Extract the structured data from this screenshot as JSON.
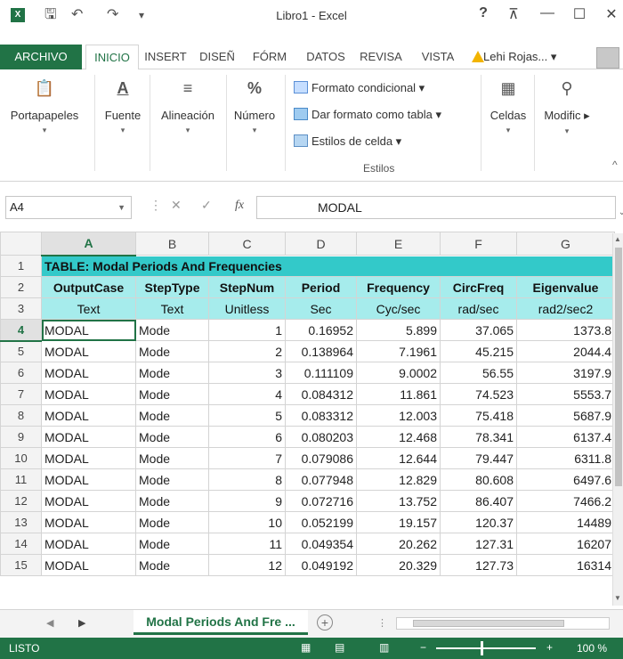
{
  "window": {
    "title": "Libro1 - Excel",
    "help": "?",
    "restore_ribbon": "⊼",
    "minimize": "—",
    "maximize": "☐",
    "close": "✕"
  },
  "ribbon_tabs": [
    "ARCHIVO",
    "INICIO",
    "INSERT",
    "DISEÑ",
    "FÓRM",
    "DATOS",
    "REVISA",
    "VISTA"
  ],
  "user_name": "Lehi Rojas... ▾",
  "ribbon": {
    "clipboard": "Portapapeles",
    "font": "Fuente",
    "alignment": "Alineación",
    "number": "Número",
    "conditional_format": "Formato condicional ▾",
    "format_as_table": "Dar formato como tabla ▾",
    "cell_styles": "Estilos de celda ▾",
    "styles_group": "Estilos",
    "cells": "Celdas",
    "modify": "Modific ▸"
  },
  "formula_bar": {
    "name_box": "A4",
    "fx": "fx",
    "value": "MODAL"
  },
  "columns": [
    "A",
    "B",
    "C",
    "D",
    "E",
    "F",
    "G"
  ],
  "rows": [
    {
      "n": "1",
      "cells": [
        "TABLE:  Modal Periods And Frequencies",
        "",
        "",
        "",
        "",
        "",
        ""
      ]
    },
    {
      "n": "2",
      "cells": [
        "OutputCase",
        "StepType",
        "StepNum",
        "Period",
        "Frequency",
        "CircFreq",
        "Eigenvalue"
      ]
    },
    {
      "n": "3",
      "cells": [
        "Text",
        "Text",
        "Unitless",
        "Sec",
        "Cyc/sec",
        "rad/sec",
        "rad2/sec2"
      ]
    },
    {
      "n": "4",
      "cells": [
        "MODAL",
        "Mode",
        "1",
        "0.16952",
        "5.899",
        "37.065",
        "1373.8"
      ]
    },
    {
      "n": "5",
      "cells": [
        "MODAL",
        "Mode",
        "2",
        "0.138964",
        "7.1961",
        "45.215",
        "2044.4"
      ]
    },
    {
      "n": "6",
      "cells": [
        "MODAL",
        "Mode",
        "3",
        "0.111109",
        "9.0002",
        "56.55",
        "3197.9"
      ]
    },
    {
      "n": "7",
      "cells": [
        "MODAL",
        "Mode",
        "4",
        "0.084312",
        "11.861",
        "74.523",
        "5553.7"
      ]
    },
    {
      "n": "8",
      "cells": [
        "MODAL",
        "Mode",
        "5",
        "0.083312",
        "12.003",
        "75.418",
        "5687.9"
      ]
    },
    {
      "n": "9",
      "cells": [
        "MODAL",
        "Mode",
        "6",
        "0.080203",
        "12.468",
        "78.341",
        "6137.4"
      ]
    },
    {
      "n": "10",
      "cells": [
        "MODAL",
        "Mode",
        "7",
        "0.079086",
        "12.644",
        "79.447",
        "6311.8"
      ]
    },
    {
      "n": "11",
      "cells": [
        "MODAL",
        "Mode",
        "8",
        "0.077948",
        "12.829",
        "80.608",
        "6497.6"
      ]
    },
    {
      "n": "12",
      "cells": [
        "MODAL",
        "Mode",
        "9",
        "0.072716",
        "13.752",
        "86.407",
        "7466.2"
      ]
    },
    {
      "n": "13",
      "cells": [
        "MODAL",
        "Mode",
        "10",
        "0.052199",
        "19.157",
        "120.37",
        "14489"
      ]
    },
    {
      "n": "14",
      "cells": [
        "MODAL",
        "Mode",
        "11",
        "0.049354",
        "20.262",
        "127.31",
        "16207"
      ]
    },
    {
      "n": "15",
      "cells": [
        "MODAL",
        "Mode",
        "12",
        "0.049192",
        "20.329",
        "127.73",
        "16314"
      ]
    }
  ],
  "sheet_tab": "Modal Periods And Fre ...",
  "add_sheet": "+",
  "status": "LISTO",
  "zoom": "100 %",
  "colors": {
    "accent": "#217346",
    "table_title": "#33c9c9",
    "table_header": "#a6ecec",
    "warning": "#f2b400"
  }
}
